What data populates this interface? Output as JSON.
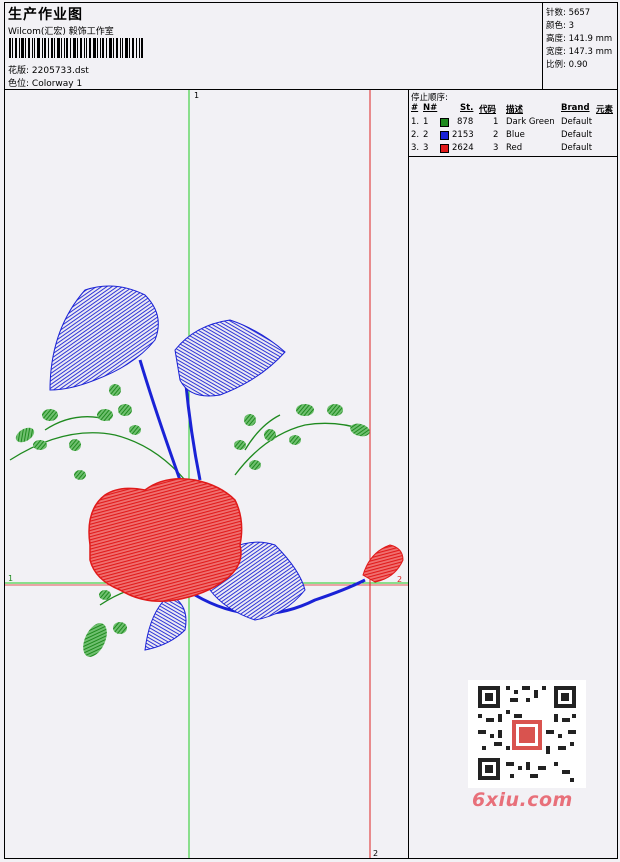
{
  "header": {
    "title": "生产作业图",
    "subtitle": "Wilcom(汇宏) 毅饰工作室",
    "design_label": "花版:",
    "design_value": "2205733.dst",
    "colorway_label": "色位:",
    "colorway_value": "Colorway 1"
  },
  "stats": [
    {
      "label": "针数:",
      "value": "5657"
    },
    {
      "label": "颜色:",
      "value": "3"
    },
    {
      "label": "高度:",
      "value": "141.9 mm"
    },
    {
      "label": "宽度:",
      "value": "147.3 mm"
    },
    {
      "label": "比例:",
      "value": "0.90"
    }
  ],
  "stop_sequence": {
    "title": "停止顺序:",
    "headers": [
      "#",
      "N#",
      "St.",
      "代码",
      "描述",
      "Brand",
      "元素"
    ],
    "rows": [
      {
        "num": "1.",
        "needle": "1",
        "color": "#1f8a1f",
        "stitches": "878",
        "code": "1",
        "description": "Dark Green",
        "brand": "Default"
      },
      {
        "num": "2.",
        "needle": "2",
        "color": "#1a22d6",
        "stitches": "2153",
        "code": "2",
        "description": "Blue",
        "brand": "Default"
      },
      {
        "num": "3.",
        "needle": "3",
        "color": "#e01a1a",
        "stitches": "2624",
        "code": "3",
        "description": "Red",
        "brand": "Default"
      }
    ]
  },
  "guides": {
    "top_marker": "1",
    "left_marker": "1",
    "right_marker": "2",
    "bottom_marker": "2"
  },
  "watermark": "6xiu.com",
  "colors": {
    "green_guide": "#22cc22",
    "red_guide": "#dd2222",
    "thread_green": "#1f8a1f",
    "thread_blue": "#1a22d6",
    "thread_red": "#e01a1a"
  }
}
